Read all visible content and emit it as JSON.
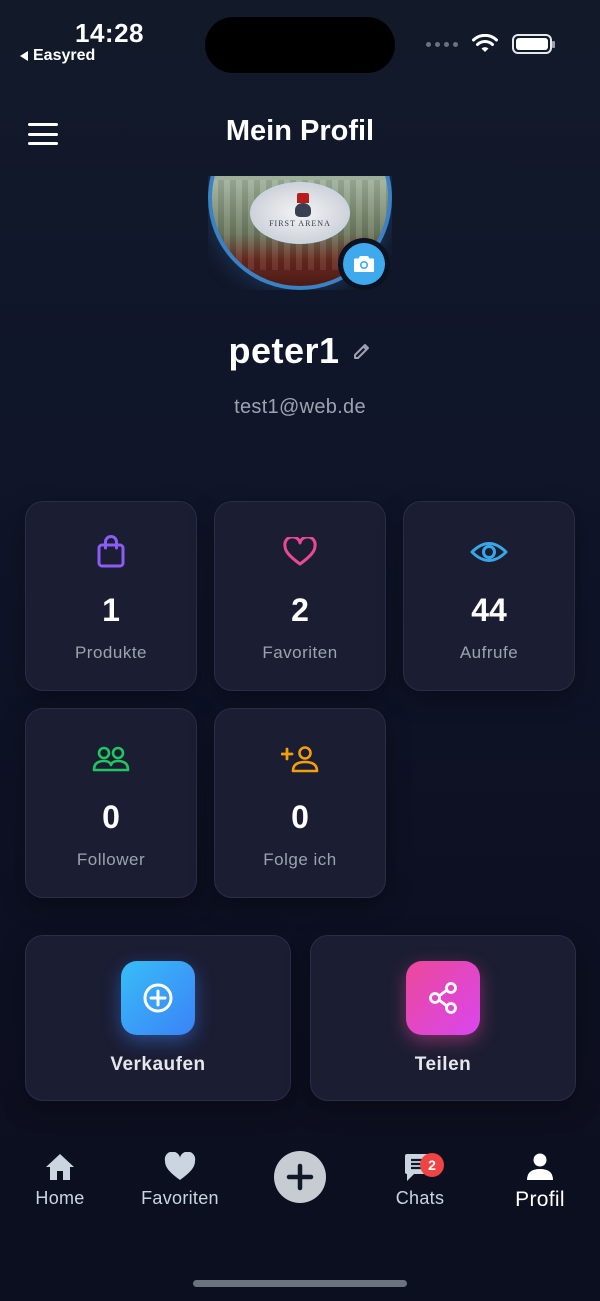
{
  "status_bar": {
    "time": "14:28",
    "back_app": "Easyred"
  },
  "header": {
    "title": "Mein Profil",
    "menu_icon": "hamburger-menu-icon"
  },
  "profile": {
    "avatar_caption": "FIRST ARENA",
    "username": "peter1",
    "email": "test1@web.de"
  },
  "stats": [
    {
      "value": "1",
      "label": "Produkte",
      "icon": "shopping-bag-icon",
      "color": "#8b5cf6"
    },
    {
      "value": "2",
      "label": "Favoriten",
      "icon": "heart-icon",
      "color": "#ec4899"
    },
    {
      "value": "44",
      "label": "Aufrufe",
      "icon": "eye-icon",
      "color": "#38a7e8"
    },
    {
      "value": "0",
      "label": "Follower",
      "icon": "people-icon",
      "color": "#22c55e"
    },
    {
      "value": "0",
      "label": "Folge ich",
      "icon": "add-person-icon",
      "color": "#f59e0b"
    }
  ],
  "actions": [
    {
      "label": "Verkaufen",
      "icon": "plus-circle-icon",
      "gradient": [
        "#38bdf8",
        "#3b82f6"
      ]
    },
    {
      "label": "Teilen",
      "icon": "share-icon",
      "gradient": [
        "#ec4899",
        "#d946ef"
      ]
    }
  ],
  "bottom_nav": {
    "items": [
      {
        "label": "Home",
        "icon": "home-icon"
      },
      {
        "label": "Favoriten",
        "icon": "heart-icon"
      },
      {
        "label": "",
        "icon": "plus-icon"
      },
      {
        "label": "Chats",
        "icon": "chat-icon",
        "badge": "2"
      },
      {
        "label": "Profil",
        "icon": "person-icon",
        "active": true
      }
    ]
  },
  "colors": {
    "accent": "#3fa9ee",
    "card_bg": "#1b1d33",
    "badge": "#ef4444"
  }
}
